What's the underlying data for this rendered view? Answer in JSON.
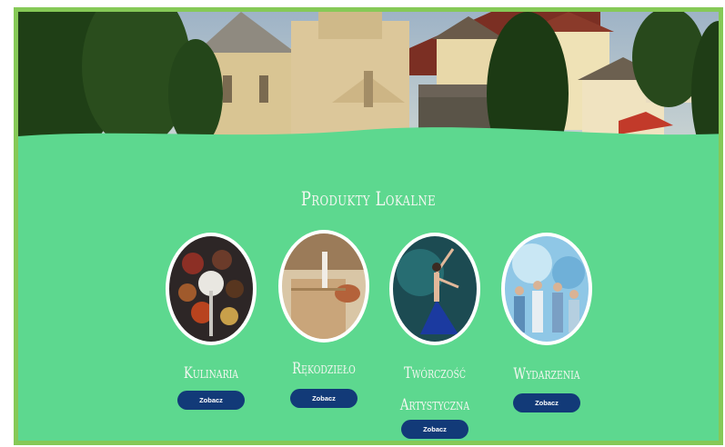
{
  "section": {
    "title": "Produkty Lokalne"
  },
  "categories": [
    {
      "label_line1": "Kulinaria",
      "label_line2": "",
      "button": "Zobacz",
      "icon": "spices-photo"
    },
    {
      "label_line1": "Rękodzieło",
      "label_line2": "",
      "button": "Zobacz",
      "icon": "crafts-photo"
    },
    {
      "label_line1": "Twórczość",
      "label_line2": "Artystyczna",
      "button": "Zobacz",
      "icon": "dancer-photo"
    },
    {
      "label_line1": "Wydarzenia",
      "label_line2": "",
      "button": "Zobacz",
      "icon": "festival-photo"
    }
  ],
  "colors": {
    "background": "#5dd88f",
    "border": "#86c957",
    "button": "#123a78",
    "text": "#f4f7f1"
  }
}
